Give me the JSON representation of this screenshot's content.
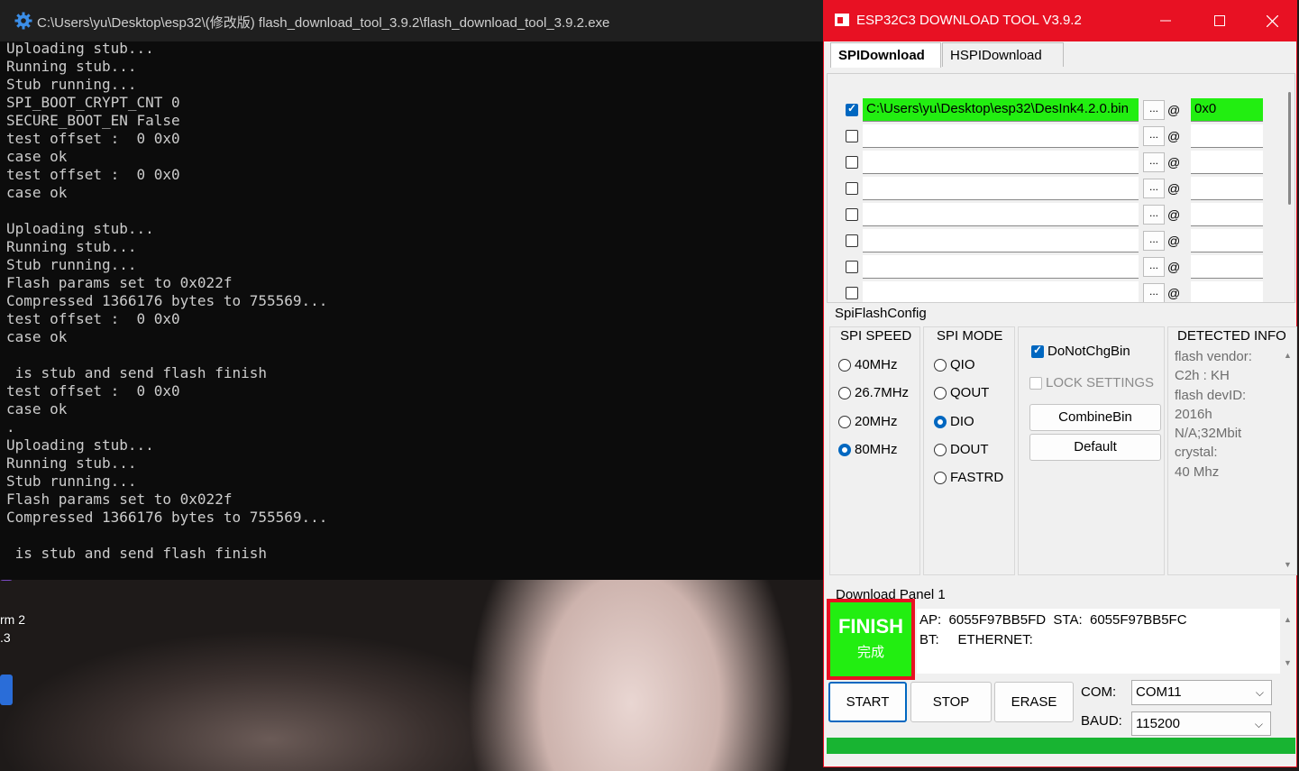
{
  "console": {
    "title": "C:\\Users\\yu\\Desktop\\esp32\\(修改版)  flash_download_tool_3.9.2\\flash_download_tool_3.9.2.exe",
    "lines": [
      "Uploading stub...",
      "Running stub...",
      "Stub running...",
      "SPI_BOOT_CRYPT_CNT 0",
      "SECURE_BOOT_EN False",
      "test offset :  0 0x0",
      "case ok",
      "test offset :  0 0x0",
      "case ok",
      "",
      "Uploading stub...",
      "Running stub...",
      "Stub running...",
      "Flash params set to 0x022f",
      "Compressed 1366176 bytes to 755569...",
      "test offset :  0 0x0",
      "case ok",
      "",
      " is stub and send flash finish",
      "test offset :  0 0x0",
      "case ok",
      ".",
      "Uploading stub...",
      "Running stub...",
      "Stub running...",
      "Flash params set to 0x022f",
      "Compressed 1366176 bytes to 755569...",
      "",
      " is stub and send flash finish"
    ]
  },
  "desktop": {
    "labels": [
      "rm 2",
      ".3"
    ]
  },
  "tool": {
    "title": "ESP32C3 DOWNLOAD TOOL V3.9.2",
    "tabs": [
      "SPIDownload",
      "HSPIDownload"
    ],
    "files": [
      {
        "checked": true,
        "path": "C:\\Users\\yu\\Desktop\\esp32\\DesInk4.2.0.bin",
        "browse": "...",
        "at": "@",
        "addr": "0x0"
      },
      {
        "checked": false,
        "path": "",
        "browse": "...",
        "at": "@",
        "addr": ""
      },
      {
        "checked": false,
        "path": "",
        "browse": "...",
        "at": "@",
        "addr": ""
      },
      {
        "checked": false,
        "path": "",
        "browse": "...",
        "at": "@",
        "addr": ""
      },
      {
        "checked": false,
        "path": "",
        "browse": "...",
        "at": "@",
        "addr": ""
      },
      {
        "checked": false,
        "path": "",
        "browse": "...",
        "at": "@",
        "addr": ""
      },
      {
        "checked": false,
        "path": "",
        "browse": "...",
        "at": "@",
        "addr": ""
      },
      {
        "checked": false,
        "path": "",
        "browse": "...",
        "at": "@",
        "addr": ""
      }
    ],
    "spi_flash_config": {
      "title": "SpiFlashConfig",
      "spi_speed": {
        "label": "SPI SPEED",
        "options": [
          "40MHz",
          "26.7MHz",
          "20MHz",
          "80MHz"
        ],
        "selected": "80MHz"
      },
      "spi_mode": {
        "label": "SPI MODE",
        "options": [
          "QIO",
          "QOUT",
          "DIO",
          "DOUT",
          "FASTRD"
        ],
        "selected": "DIO"
      },
      "do_not_chg_bin": {
        "label": "DoNotChgBin",
        "checked": true
      },
      "lock_settings": {
        "label": "LOCK SETTINGS",
        "checked": false
      },
      "combine_bin_label": "CombineBin",
      "default_label": "Default",
      "detected_info": {
        "label": "DETECTED INFO",
        "lines": [
          "flash vendor:",
          "C2h : KH",
          "flash devID:",
          "2016h",
          "N/A;32Mbit",
          "crystal:",
          "40 Mhz"
        ]
      }
    },
    "download_panel": {
      "title": "Download Panel 1",
      "status": "FINISH",
      "status_cn": "完成",
      "status_color": "#22ee11",
      "mac_line1": "AP:  6055F97BB5FD  STA:  6055F97BB5FC",
      "mac_line2": "BT:     ETHERNET:"
    },
    "buttons": {
      "start": "START",
      "stop": "STOP",
      "erase": "ERASE"
    },
    "com": {
      "label": "COM:",
      "value": "COM11"
    },
    "baud": {
      "label": "BAUD:",
      "value": "115200"
    },
    "progress": 1.0,
    "colors": {
      "accent": "#e81123",
      "ok_green": "#22ee11",
      "progress": "#18b432",
      "select_blue": "#0067c0"
    }
  }
}
